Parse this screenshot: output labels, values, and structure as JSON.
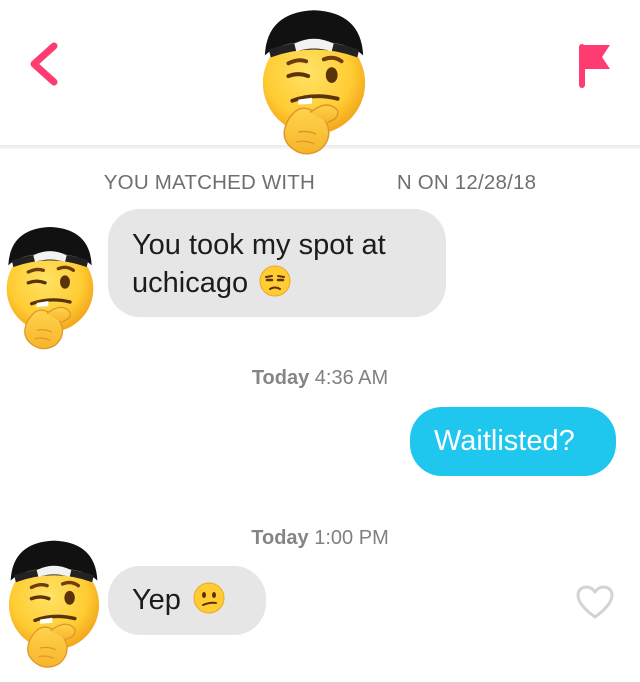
{
  "header": {
    "back_icon": "chevron-left-icon",
    "report_icon": "flag-icon",
    "avatar_icon": "face-with-hand-cap-emoji",
    "accent_color": "#fe3c72"
  },
  "match": {
    "prefix": "YOU MATCHED WITH",
    "suffix": "N ON 12/28/18"
  },
  "messages": [
    {
      "direction": "incoming",
      "line1": "You took my spot at",
      "line2": "uchicago",
      "emoji": "unamused-face"
    },
    {
      "direction": "outgoing",
      "text": "Waitlisted?"
    },
    {
      "direction": "incoming",
      "text": "Yep",
      "emoji": "confused-face"
    }
  ],
  "stamps": [
    {
      "day": "Today",
      "time": "4:36 AM"
    },
    {
      "day": "Today",
      "time": "1:00 PM"
    }
  ],
  "footer": {
    "like_icon": "heart-outline-icon"
  },
  "colors": {
    "incoming_bubble": "#e6e6e6",
    "outgoing_bubble": "#1fc7ee"
  }
}
